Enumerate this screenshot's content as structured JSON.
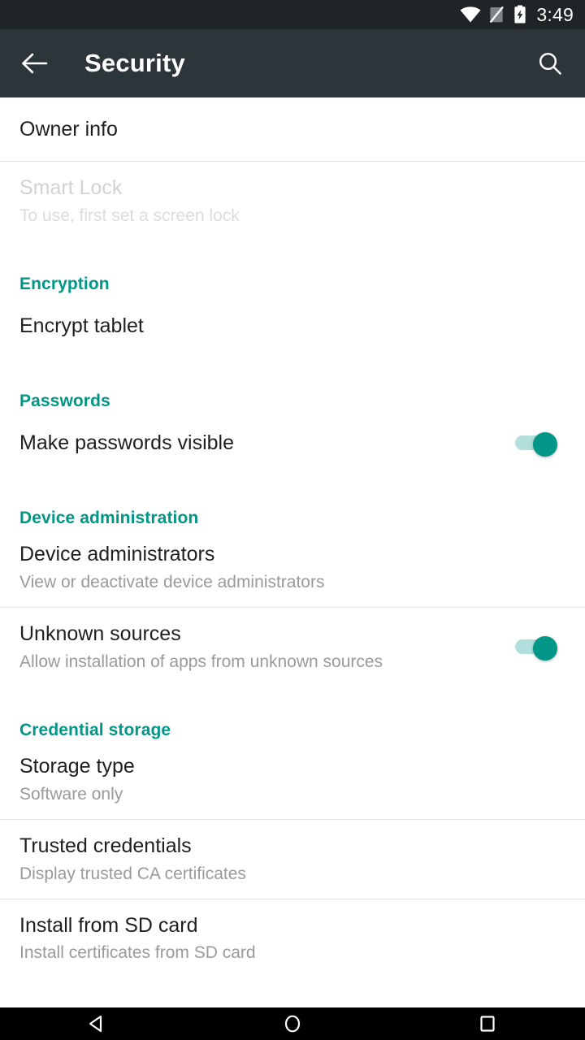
{
  "status_bar": {
    "time": "3:49",
    "icons": [
      "wifi-icon",
      "cellular-off-icon",
      "battery-charging-icon"
    ]
  },
  "app_bar": {
    "title": "Security",
    "back_icon": "arrow-left-icon",
    "search_icon": "search-icon",
    "background": "#2c3539"
  },
  "theme": {
    "accent": "#009688",
    "switch_track_on": "#b2dfdb",
    "title_color": "#1f1f1f",
    "summary_color": "#9a9a9a",
    "disabled_color": "#d2d2d2",
    "divider": "#e0e0e0"
  },
  "list": [
    {
      "kind": "preference",
      "name": "owner-info",
      "title": "Owner info",
      "summary": "",
      "enabled": true,
      "divider_after": true
    },
    {
      "kind": "preference",
      "name": "smart-lock",
      "title": "Smart Lock",
      "summary": "To use, first set a screen lock",
      "enabled": false,
      "divider_after": false
    },
    {
      "kind": "header",
      "name": "encryption",
      "title": "Encryption"
    },
    {
      "kind": "preference",
      "name": "encrypt-tablet",
      "title": "Encrypt tablet",
      "summary": "",
      "enabled": true,
      "divider_after": false
    },
    {
      "kind": "header",
      "name": "passwords",
      "title": "Passwords"
    },
    {
      "kind": "switch",
      "name": "make-passwords-visible",
      "title": "Make passwords visible",
      "summary": "",
      "checked": true,
      "divider_after": false
    },
    {
      "kind": "header",
      "name": "device-administration",
      "title": "Device administration"
    },
    {
      "kind": "preference",
      "name": "device-administrators",
      "title": "Device administrators",
      "summary": "View or deactivate device administrators",
      "enabled": true,
      "divider_after": true
    },
    {
      "kind": "switch",
      "name": "unknown-sources",
      "title": "Unknown sources",
      "summary": "Allow installation of apps from unknown sources",
      "checked": true,
      "divider_after": false
    },
    {
      "kind": "header",
      "name": "credential-storage",
      "title": "Credential storage"
    },
    {
      "kind": "preference",
      "name": "storage-type",
      "title": "Storage type",
      "summary": "Software only",
      "enabled": true,
      "divider_after": true
    },
    {
      "kind": "preference",
      "name": "trusted-credentials",
      "title": "Trusted credentials",
      "summary": "Display trusted CA certificates",
      "enabled": true,
      "divider_after": true
    },
    {
      "kind": "preference",
      "name": "install-from-sd-card",
      "title": "Install from SD card",
      "summary": "Install certificates from SD card",
      "enabled": true,
      "divider_after": false
    }
  ],
  "nav_bar": {
    "back": "nav-back-icon",
    "home": "nav-home-icon",
    "recents": "nav-recents-icon"
  }
}
